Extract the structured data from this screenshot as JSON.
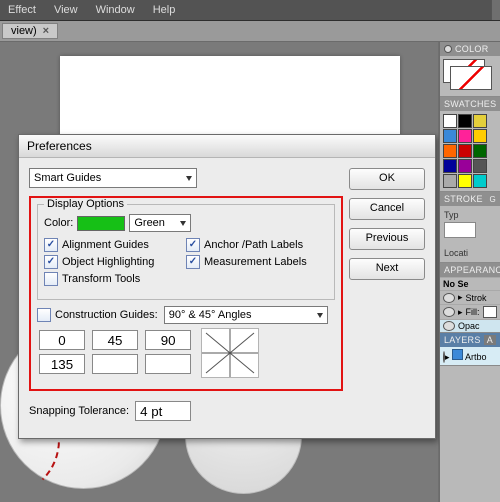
{
  "menu": {
    "items": [
      "Effect",
      "View",
      "Window",
      "Help"
    ]
  },
  "tab": {
    "label": "view)",
    "close": "×"
  },
  "dialog": {
    "title": "Preferences",
    "section": "Smart Guides",
    "display_legend": "Display Options",
    "color_label": "Color:",
    "color_value": "Green",
    "checkboxes": {
      "alignment": {
        "label": "Alignment Guides",
        "checked": true
      },
      "highlight": {
        "label": "Object Highlighting",
        "checked": true
      },
      "transform": {
        "label": "Transform Tools",
        "checked": false
      },
      "anchor": {
        "label": "Anchor /Path Labels",
        "checked": true
      },
      "measure": {
        "label": "Measurement Labels",
        "checked": true
      }
    },
    "construction": {
      "label": "Construction Guides:",
      "checked": false,
      "value": "90° & 45° Angles"
    },
    "angles": [
      "0",
      "45",
      "90",
      "135",
      "",
      ""
    ],
    "snap_label": "Snapping Tolerance:",
    "snap_value": "4 pt",
    "buttons": {
      "ok": "OK",
      "cancel": "Cancel",
      "prev": "Previous",
      "next": "Next"
    }
  },
  "panels": {
    "color": "COLOR",
    "swatches": "SWATCHES",
    "swatch_colors": [
      "#fff",
      "#000",
      "#e4cf3a",
      "#3a88d8",
      "#f29",
      "#fc0",
      "#f60",
      "#c00",
      "#060",
      "#009",
      "#909",
      "#555",
      "#aaa",
      "#ff0",
      "#0cc"
    ],
    "stroke": "STROKE",
    "stroke_type": "Typ",
    "stroke_loc": "Locati",
    "appearance": "APPEARANCE",
    "app_nosel": "No Se",
    "app_stroke": "Strok",
    "app_fill": "Fill:",
    "app_opac": "Opac",
    "layers": "LAYERS",
    "layers_a": "A",
    "layer_item": "Artbo"
  }
}
